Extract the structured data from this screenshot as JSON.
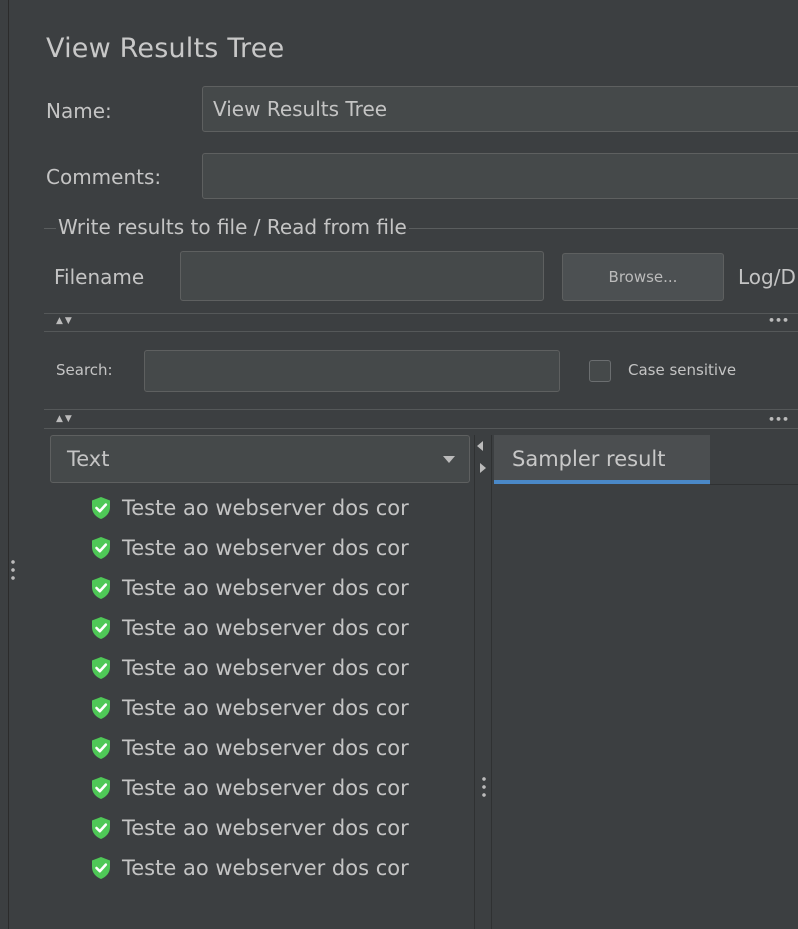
{
  "panel": {
    "title": "View Results Tree",
    "name_label": "Name:",
    "name_value": "View Results Tree",
    "comments_label": "Comments:",
    "comments_value": ""
  },
  "file_section": {
    "legend": "Write results to file / Read from file",
    "filename_label": "Filename",
    "filename_value": "",
    "browse_label": "Browse...",
    "log_label": "Log/D"
  },
  "search": {
    "label": "Search:",
    "value": "",
    "case_sensitive_label": "Case sensitive",
    "case_sensitive_checked": false
  },
  "renderer": {
    "selected": "Text"
  },
  "tree": {
    "items": [
      "Teste ao webserver dos cor",
      "Teste ao webserver dos cor",
      "Teste ao webserver dos cor",
      "Teste ao webserver dos cor",
      "Teste ao webserver dos cor",
      "Teste ao webserver dos cor",
      "Teste ao webserver dos cor",
      "Teste ao webserver dos cor",
      "Teste ao webserver dos cor",
      "Teste ao webserver dos cor"
    ],
    "status_icon": "shield-check-icon",
    "status_color": "#4fc857"
  },
  "result_tabs": {
    "active": "Sampler result"
  },
  "colors": {
    "background": "#3c3f41",
    "accent": "#4a88c7"
  }
}
